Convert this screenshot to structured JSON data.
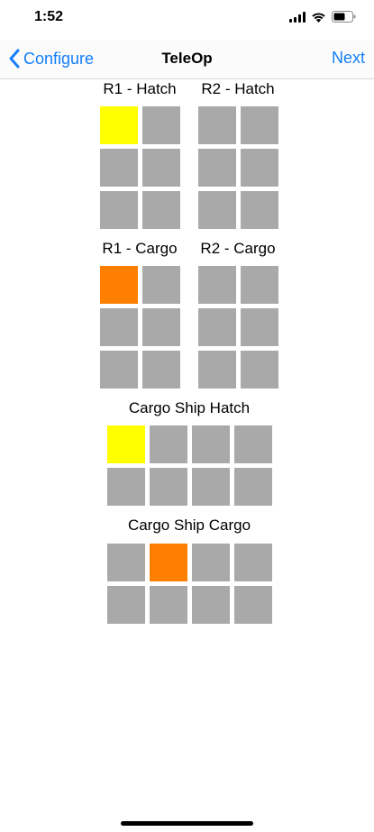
{
  "status": {
    "time": "1:52"
  },
  "nav": {
    "back_label": "Configure",
    "title": "TeleOp",
    "next_label": "Next"
  },
  "colors": {
    "empty": "#a9a9a9",
    "hatch": "#ffff00",
    "cargo": "#ff8000",
    "link": "#147efb"
  },
  "sections": {
    "r1_hatch": {
      "label": "R1 - Hatch",
      "grid": [
        [
          "hatch",
          "empty"
        ],
        [
          "empty",
          "empty"
        ],
        [
          "empty",
          "empty"
        ]
      ]
    },
    "r2_hatch": {
      "label": "R2 - Hatch",
      "grid": [
        [
          "empty",
          "empty"
        ],
        [
          "empty",
          "empty"
        ],
        [
          "empty",
          "empty"
        ]
      ]
    },
    "r1_cargo": {
      "label": "R1 - Cargo",
      "grid": [
        [
          "cargo",
          "empty"
        ],
        [
          "empty",
          "empty"
        ],
        [
          "empty",
          "empty"
        ]
      ]
    },
    "r2_cargo": {
      "label": "R2 - Cargo",
      "grid": [
        [
          "empty",
          "empty"
        ],
        [
          "empty",
          "empty"
        ],
        [
          "empty",
          "empty"
        ]
      ]
    },
    "ship_hatch": {
      "label": "Cargo Ship Hatch",
      "grid": [
        [
          "hatch",
          "empty",
          "empty",
          "empty"
        ],
        [
          "empty",
          "empty",
          "empty",
          "empty"
        ]
      ]
    },
    "ship_cargo": {
      "label": "Cargo Ship Cargo",
      "grid": [
        [
          "empty",
          "cargo",
          "empty",
          "empty"
        ],
        [
          "empty",
          "empty",
          "empty",
          "empty"
        ]
      ]
    }
  }
}
